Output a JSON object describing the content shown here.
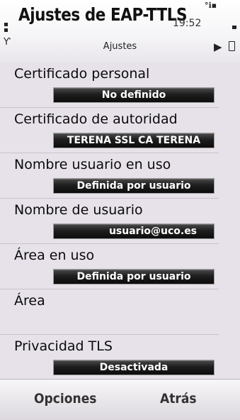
{
  "header": {
    "title": "Ajustes de EAP-TTLS",
    "time": "19:52",
    "subtitle": "Ajustes"
  },
  "icons": {
    "signal": "antenna-icon",
    "network": "3g-network-icon",
    "navigation": "play-arrow-icon",
    "battery": "battery-icon"
  },
  "settings": [
    {
      "label": "Certificado personal",
      "value": "No definido"
    },
    {
      "label": "Certificado de autoridad",
      "value": "TERENA SSL CA TERENA"
    },
    {
      "label": "Nombre usuario en uso",
      "value": "Definida por usuario"
    },
    {
      "label": "Nombre de usuario",
      "value": "usuario@uco.es"
    },
    {
      "label": "Área en uso",
      "value": "Definida por usuario"
    },
    {
      "label": "Área",
      "value": ""
    },
    {
      "label": "Privacidad TLS",
      "value": "Desactivada"
    }
  ],
  "softkeys": {
    "left": "Opciones",
    "right": "Atrás"
  }
}
